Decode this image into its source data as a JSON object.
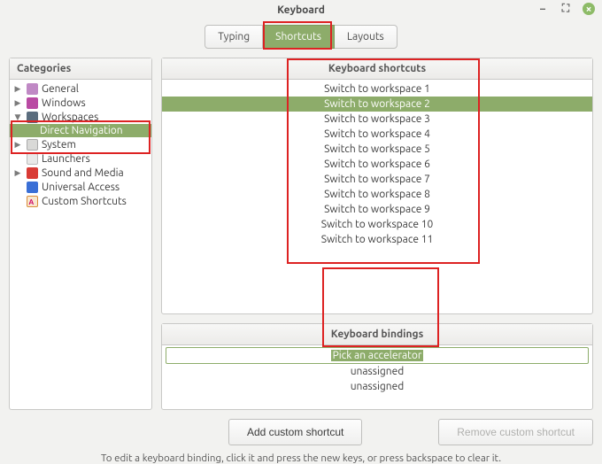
{
  "window": {
    "title": "Keyboard"
  },
  "tabs": [
    {
      "label": "Typing",
      "active": false
    },
    {
      "label": "Shortcuts",
      "active": true
    },
    {
      "label": "Layouts",
      "active": false
    }
  ],
  "sidebar": {
    "header": "Categories",
    "items": [
      {
        "label": "General",
        "icon": "general",
        "expandable": true,
        "expanded": false
      },
      {
        "label": "Windows",
        "icon": "windows",
        "expandable": true,
        "expanded": false
      },
      {
        "label": "Workspaces",
        "icon": "workspaces",
        "expandable": true,
        "expanded": true,
        "children": [
          {
            "label": "Direct Navigation",
            "selected": true
          }
        ]
      },
      {
        "label": "System",
        "icon": "system",
        "expandable": true,
        "expanded": false
      },
      {
        "label": "Launchers",
        "icon": "launchers",
        "expandable": false
      },
      {
        "label": "Sound and Media",
        "icon": "media",
        "expandable": true,
        "expanded": false
      },
      {
        "label": "Universal Access",
        "icon": "access",
        "expandable": false
      },
      {
        "label": "Custom Shortcuts",
        "icon": "custom",
        "expandable": false
      }
    ]
  },
  "shortcuts": {
    "header": "Keyboard shortcuts",
    "items": [
      {
        "label": "Switch to workspace 1",
        "selected": false
      },
      {
        "label": "Switch to workspace 2",
        "selected": true
      },
      {
        "label": "Switch to workspace 3",
        "selected": false
      },
      {
        "label": "Switch to workspace 4",
        "selected": false
      },
      {
        "label": "Switch to workspace 5",
        "selected": false
      },
      {
        "label": "Switch to workspace 6",
        "selected": false
      },
      {
        "label": "Switch to workspace 7",
        "selected": false
      },
      {
        "label": "Switch to workspace 8",
        "selected": false
      },
      {
        "label": "Switch to workspace 9",
        "selected": false
      },
      {
        "label": "Switch to workspace 10",
        "selected": false
      },
      {
        "label": "Switch to workspace 11",
        "selected": false
      }
    ]
  },
  "bindings": {
    "header": "Keyboard bindings",
    "items": [
      {
        "label": "Pick an accelerator",
        "editing": true
      },
      {
        "label": "unassigned",
        "editing": false
      },
      {
        "label": "unassigned",
        "editing": false
      }
    ]
  },
  "buttons": {
    "add": "Add custom shortcut",
    "remove": "Remove custom shortcut"
  },
  "footer": "To edit a keyboard binding, click it and press the new keys, or press backspace to clear it."
}
